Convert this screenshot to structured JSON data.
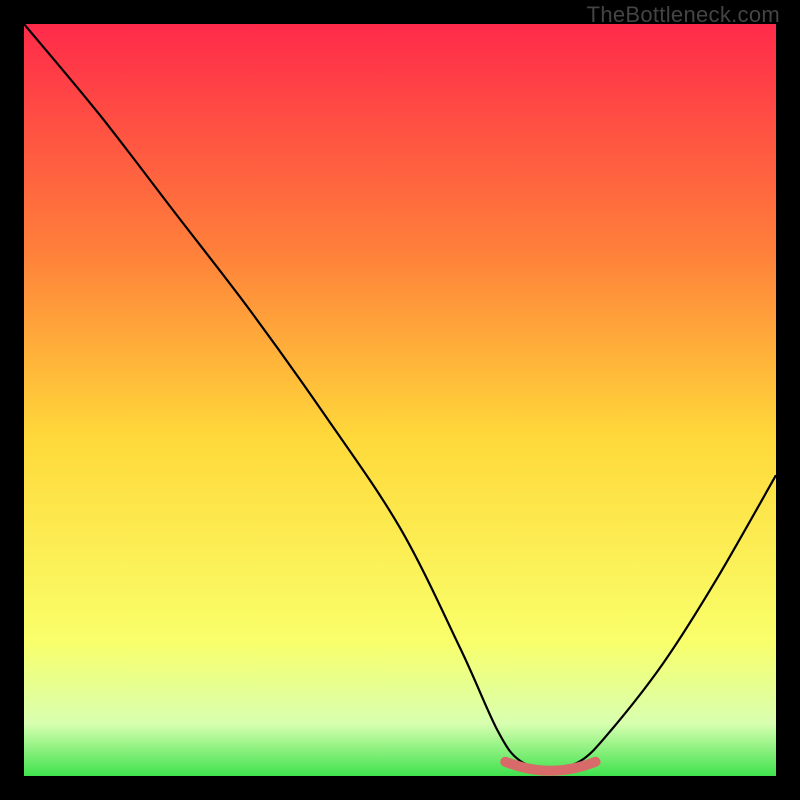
{
  "watermark": "TheBottleneck.com",
  "chart_data": {
    "type": "line",
    "title": "",
    "xlabel": "",
    "ylabel": "",
    "xlim": [
      0,
      100
    ],
    "ylim": [
      0,
      100
    ],
    "background_gradient": {
      "top": "#ff2a4a",
      "mid1": "#ff7f3a",
      "mid2": "#ffd93a",
      "mid3": "#f9ff6a",
      "bottom": "#3fe24d"
    },
    "curve": {
      "description": "V-shaped bottleneck curve, minimum near x≈70",
      "points": [
        {
          "x": 0,
          "y": 100
        },
        {
          "x": 10,
          "y": 88
        },
        {
          "x": 20,
          "y": 75
        },
        {
          "x": 30,
          "y": 62
        },
        {
          "x": 40,
          "y": 48
        },
        {
          "x": 50,
          "y": 33
        },
        {
          "x": 58,
          "y": 17
        },
        {
          "x": 63,
          "y": 6
        },
        {
          "x": 66,
          "y": 2
        },
        {
          "x": 70,
          "y": 1
        },
        {
          "x": 74,
          "y": 2
        },
        {
          "x": 78,
          "y": 6
        },
        {
          "x": 85,
          "y": 15
        },
        {
          "x": 92,
          "y": 26
        },
        {
          "x": 100,
          "y": 40
        }
      ]
    },
    "optimal_marker": {
      "description": "short salmon/red segment at the curve minimum",
      "x_start": 64,
      "x_end": 76,
      "y": 1.5,
      "color": "#d86a6a"
    }
  }
}
